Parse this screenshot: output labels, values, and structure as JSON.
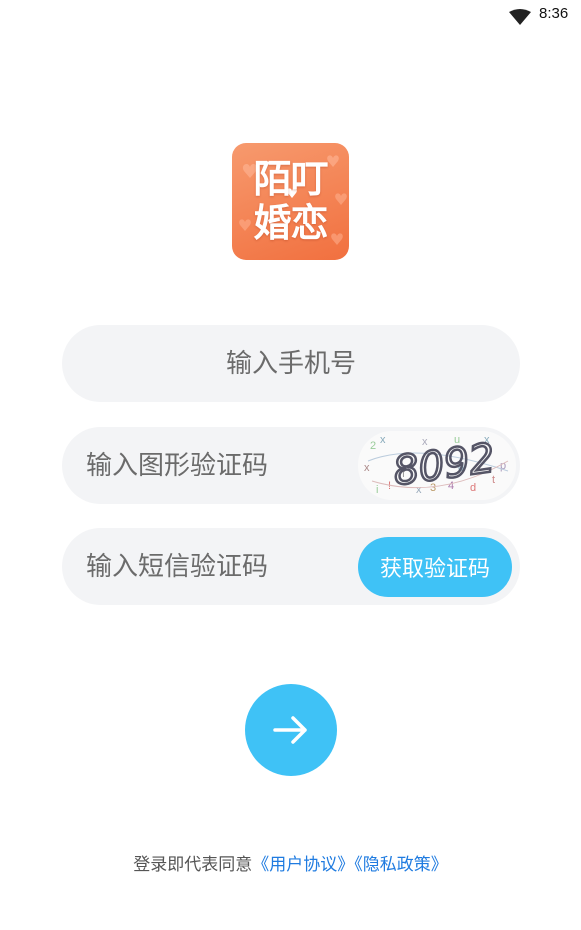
{
  "status_bar": {
    "time": "8:36",
    "icons": [
      "wifi-icon"
    ]
  },
  "logo": {
    "line1": "陌叮",
    "line2": "婚恋",
    "colors": {
      "start": "#f79a6e",
      "end": "#f1703f"
    }
  },
  "form": {
    "phone": {
      "placeholder": "输入手机号",
      "value": ""
    },
    "captcha": {
      "placeholder": "输入图形验证码",
      "value": "",
      "image_text": "8092"
    },
    "sms": {
      "placeholder": "输入短信验证码",
      "value": "",
      "button_label": "获取验证码"
    },
    "submit_icon": "arrow-right-icon"
  },
  "agreement": {
    "prefix": "登录即代表同意",
    "user_agreement": "《用户协议》",
    "privacy_policy": "《隐私政策》"
  },
  "colors": {
    "accent": "#3fc2f6",
    "link": "#1f7be0",
    "field_bg": "#f3f4f6"
  }
}
